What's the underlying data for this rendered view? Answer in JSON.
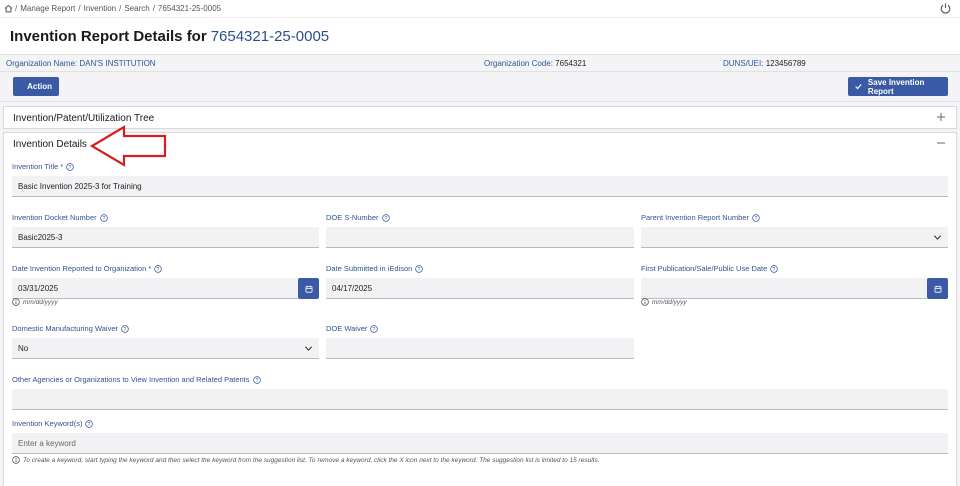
{
  "breadcrumb": {
    "items": [
      "Manage Report",
      "Invention",
      "Search",
      "7654321-25-0005"
    ],
    "separator": "/"
  },
  "header": {
    "title": "Invention Report Details for",
    "report_id": "7654321-25-0005"
  },
  "org_info": {
    "name_label": "Organization Name:",
    "name_value": "DAN'S INSTITUTION",
    "code_label": "Organization Code:",
    "code_value": "7654321",
    "duns_label": "DUNS/UEI:",
    "duns_value": "123456789"
  },
  "toolbar": {
    "action_label": "Action",
    "save_label": "Save Invention Report"
  },
  "panels": {
    "tree_title": "Invention/Patent/Utilization Tree",
    "details_title": "Invention Details"
  },
  "form": {
    "invention_title": {
      "label": "Invention Title *",
      "value": "Basic Invention 2025-3 for Training"
    },
    "docket_number": {
      "label": "Invention Docket Number",
      "value": "Basic2025-3"
    },
    "doe_s_number": {
      "label": "DOE S-Number",
      "value": ""
    },
    "parent_report_number": {
      "label": "Parent Invention Report Number",
      "value": ""
    },
    "date_reported": {
      "label": "Date Invention Reported to Organization *",
      "value": "03/31/2025",
      "hint": "mm/dd/yyyy"
    },
    "date_submitted": {
      "label": "Date Submitted in iEdison",
      "value": "04/17/2025"
    },
    "first_publication": {
      "label": "First Publication/Sale/Public Use Date",
      "value": "",
      "hint": "mm/dd/yyyy"
    },
    "manufacturing_waiver": {
      "label": "Domestic Manufacturing Waiver",
      "value": "No"
    },
    "doe_waiver": {
      "label": "DOE Waiver",
      "value": ""
    },
    "other_agencies": {
      "label": "Other Agencies or Organizations to View Invention and Related Patents",
      "value": ""
    },
    "keywords": {
      "label": "Invention Keyword(s)",
      "placeholder": "Enter a keyword",
      "hint": "To create a keyword, start typing the keyword and then select the keyword from the suggestion list. To remove a keyword, click the X icon next to the keyword. The suggestion list is limited to 15 results."
    }
  },
  "colors": {
    "accent": "#3b5aa5",
    "label_blue": "#2e5596",
    "arrow_red": "#d32020",
    "panel_bg": "#f4f4f6"
  },
  "icons": {
    "home": "home-icon",
    "power": "power-icon",
    "action_chevron": "chevron-down-icon",
    "save_check": "check-icon",
    "expand": "plus-icon",
    "collapse": "minus-icon",
    "help": "help-icon",
    "calendar": "calendar-icon",
    "info": "info-icon"
  }
}
